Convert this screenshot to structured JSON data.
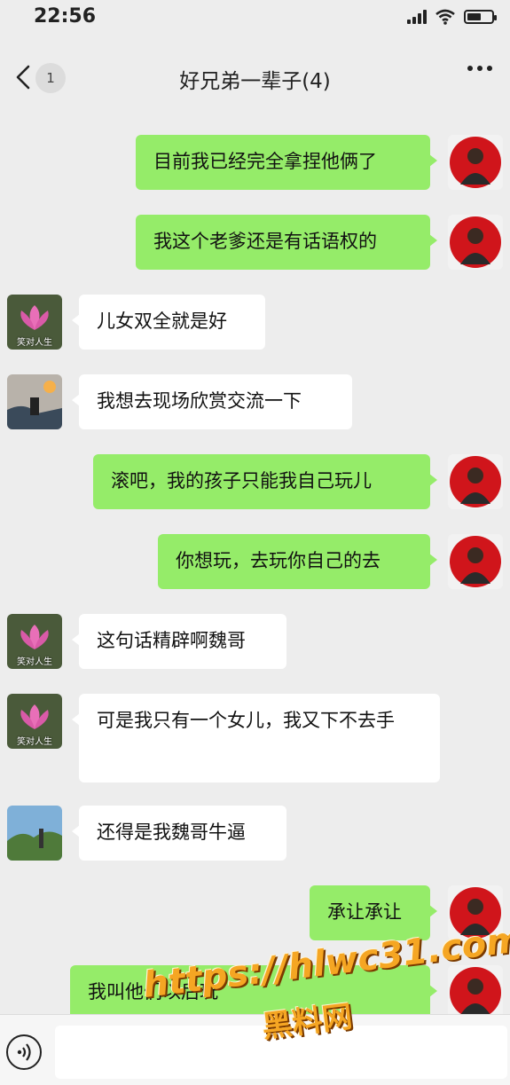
{
  "status_bar": {
    "time": "22:56",
    "signal_icon": "cellular-signal-icon",
    "wifi_icon": "wifi-icon",
    "battery_icon": "battery-icon",
    "battery_level": 0.5
  },
  "nav": {
    "back_icon": "chevron-left-icon",
    "unread_count": "1",
    "title": "好兄弟一辈子(4)",
    "more_icon": "more-dots-icon"
  },
  "colors": {
    "outgoing_bubble": "#95ec69",
    "incoming_bubble": "#ffffff",
    "background": "#ededed"
  },
  "messages": [
    {
      "side": "out",
      "sender": "self",
      "text": "目前我已经完全拿捏他俩了"
    },
    {
      "side": "out",
      "sender": "self",
      "text": "我这个老爹还是有话语权的"
    },
    {
      "side": "in",
      "sender": "lotus",
      "text": "儿女双全就是好"
    },
    {
      "side": "in",
      "sender": "sunset",
      "text": "我想去现场欣赏交流一下"
    },
    {
      "side": "out",
      "sender": "self",
      "text": "滚吧，我的孩子只能我自己玩儿"
    },
    {
      "side": "out",
      "sender": "self",
      "text": "你想玩，去玩你自己的去"
    },
    {
      "side": "in",
      "sender": "lotus",
      "text": "这句话精辟啊魏哥"
    },
    {
      "side": "in",
      "sender": "lotus",
      "text": "可是我只有一个女儿，我又下不去手"
    },
    {
      "side": "in",
      "sender": "landscape",
      "text": "还得是我魏哥牛逼"
    },
    {
      "side": "out",
      "sender": "self",
      "text": "承让承让"
    },
    {
      "side": "out",
      "sender": "self",
      "text": "我叫他们以后玩"
    }
  ],
  "avatars": {
    "lotus_caption": "笑对人生"
  },
  "input_bar": {
    "voice_icon": "voice-icon"
  },
  "watermark": {
    "line1": "https://hlwc31.com",
    "line2": "黑料网"
  }
}
